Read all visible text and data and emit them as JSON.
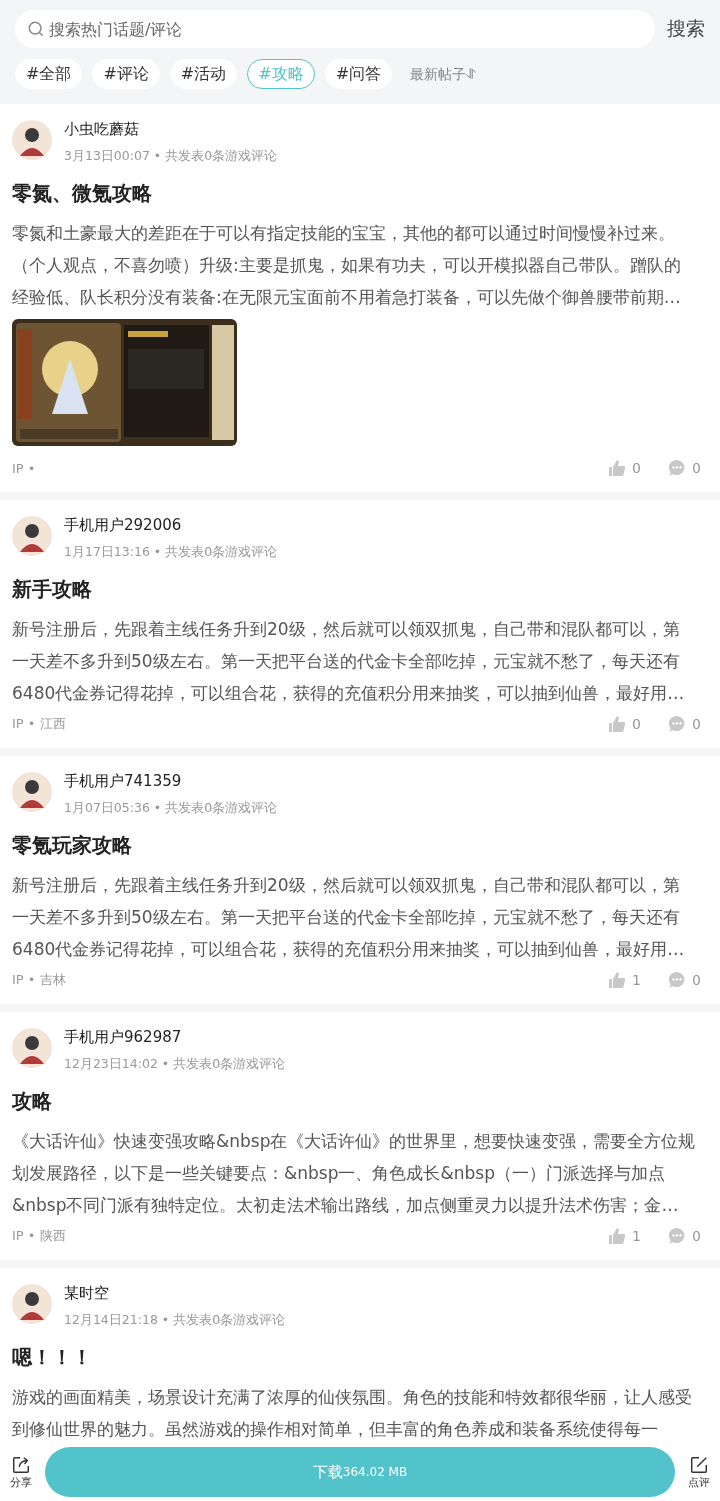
{
  "search": {
    "placeholder": "搜索热门话题/评论",
    "button": "搜索"
  },
  "tags": [
    {
      "label": "#全部",
      "selected": false
    },
    {
      "label": "#评论",
      "selected": false
    },
    {
      "label": "#活动",
      "selected": false
    },
    {
      "label": "#攻略",
      "selected": true
    },
    {
      "label": "#问答",
      "selected": false
    }
  ],
  "sort": "最新帖子⥯",
  "posts": [
    {
      "author": "小虫吃蘑菇",
      "meta": "3月13日00:07 • 共发表0条游戏评论",
      "title": "零氮、微氪攻略",
      "body": "零氮和土豪最大的差距在于可以有指定技能的宝宝，其他的都可以通过时间慢慢补过来。（个人观点，不喜勿喷）升级:主要是抓鬼，如果有功夫，可以开模拟器自己带队。蹭队的经验低、队长积分没有装备:在无限元宝面前不用着急打装备，可以先做个御兽腰带前期…",
      "ip": "IP •",
      "likes": "0",
      "comments": "0"
    },
    {
      "author": "手机用户292006",
      "meta": "1月17日13:16 • 共发表0条游戏评论",
      "title": "新手攻略",
      "body": "新号注册后，先跟着主线任务升到20级，然后就可以领双抓鬼，自己带和混队都可以，第一天差不多升到50级左右。第一天把平台送的代金卡全部吃掉，元宝就不愁了，每天还有6480代金券记得花掉，可以组合花，获得的充值积分用来抽奖，可以抽到仙兽，最好用…",
      "ip": "IP • 江西",
      "likes": "0",
      "comments": "0"
    },
    {
      "author": "手机用户741359",
      "meta": "1月07日05:36 • 共发表0条游戏评论",
      "title": "零氪玩家攻略",
      "body": "新号注册后，先跟着主线任务升到20级，然后就可以领双抓鬼，自己带和混队都可以，第一天差不多升到50级左右。第一天把平台送的代金卡全部吃掉，元宝就不愁了，每天还有6480代金券记得花掉，可以组合花，获得的充值积分用来抽奖，可以抽到仙兽，最好用…",
      "ip": "IP • 吉林",
      "likes": "1",
      "comments": "0"
    },
    {
      "author": "手机用户962987",
      "meta": "12月23日14:02 • 共发表0条游戏评论",
      "title": "攻略",
      "body": "《大话许仙》快速变强攻略&nbsp在《大话许仙》的世界里，想要快速变强，需要全方位规划发展路径，以下是一些关键要点：&nbsp一、角色成长&nbsp（一）门派选择与加点&nbsp不同门派有独特定位。太初走法术输出路线，加点侧重灵力以提升法术伤害；金…",
      "ip": "IP • 陕西",
      "likes": "1",
      "comments": "0"
    },
    {
      "author": "某时空",
      "meta": "12月14日21:18 • 共发表0条游戏评论",
      "title": "嗯！！！",
      "body": "游戏的画面精美，场景设计充满了浓厚的仙侠氛围。角色的技能和特效都很华丽，让人感受到修仙世界的魅力。虽然游戏的操作相对简单，但丰富的角色养成和装备系统使得每一"
    }
  ],
  "bottom_bar": {
    "share": "分享",
    "download": "下载",
    "size": "364.02 MB",
    "review": "点评"
  }
}
